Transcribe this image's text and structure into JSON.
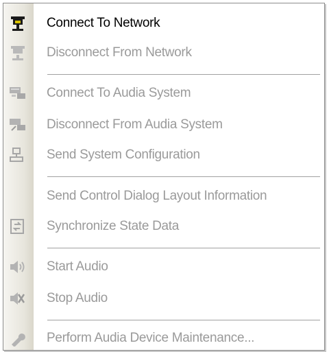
{
  "menu": {
    "items": [
      {
        "label": "Connect To Network",
        "enabled": true,
        "icon": "network-plug-icon"
      },
      {
        "label": "Disconnect From Network",
        "enabled": false,
        "icon": "network-unplug-icon"
      },
      {
        "label": "Connect To Audia System",
        "enabled": false,
        "icon": "audia-connect-icon"
      },
      {
        "label": "Disconnect From Audia System",
        "enabled": false,
        "icon": "audia-disconnect-icon"
      },
      {
        "label": "Send System Configuration",
        "enabled": false,
        "icon": "send-config-icon"
      },
      {
        "label": "Send Control Dialog Layout Information",
        "enabled": false,
        "icon": "none"
      },
      {
        "label": "Synchronize State Data",
        "enabled": false,
        "icon": "sync-icon"
      },
      {
        "label": "Start Audio",
        "enabled": false,
        "icon": "speaker-icon"
      },
      {
        "label": "Stop Audio",
        "enabled": false,
        "icon": "stop-audio-icon"
      },
      {
        "label": "Perform Audia Device Maintenance...",
        "enabled": false,
        "icon": "wrench-icon"
      }
    ]
  },
  "colors": {
    "enabled_text": "#000000",
    "disabled_text": "#9a9a9a",
    "gutter": "#e7e5dc"
  }
}
